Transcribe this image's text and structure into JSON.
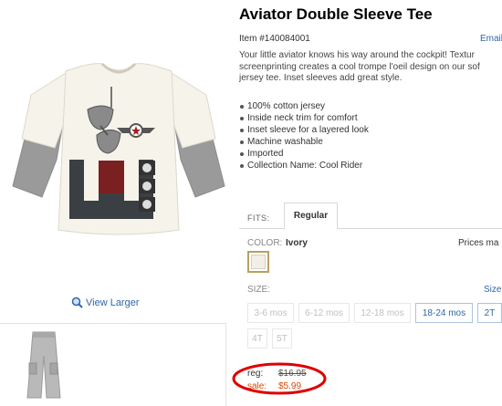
{
  "product": {
    "title": "Aviator Double Sleeve Tee",
    "item_number": "Item #140084001",
    "email_link": "Email",
    "description_lines": [
      "Your little aviator knows his way around the cockpit! Textur",
      "screenprinting creates a cool trompe l'oeil design on our sof",
      "jersey tee. Inset sleeves add great style."
    ],
    "features": [
      "100% cotton jersey",
      "Inside neck trim for comfort",
      "Inset sleeve for a layered look",
      "Machine washable",
      "Imported",
      "Collection Name: Cool Rider"
    ]
  },
  "gallery": {
    "view_larger": "View Larger",
    "main_image": "ivory-tee-gray-sleeves",
    "thumbnail": "gray-cargo-pants"
  },
  "fits": {
    "label": "FITS:",
    "tab": "Regular"
  },
  "color": {
    "label": "COLOR:",
    "value": "Ivory",
    "prices_note": "Prices ma",
    "swatch_color": "#f3efe6"
  },
  "size": {
    "label": "SIZE:",
    "chart_link": "Size",
    "options": [
      {
        "label": "3-6 mos",
        "available": false
      },
      {
        "label": "6-12 mos",
        "available": false
      },
      {
        "label": "12-18 mos",
        "available": false
      },
      {
        "label": "18-24 mos",
        "available": true
      },
      {
        "label": "2T",
        "available": true
      },
      {
        "label": "4T",
        "available": false
      },
      {
        "label": "5T",
        "available": false
      }
    ]
  },
  "price": {
    "reg_label": "reg:",
    "reg_value": "$16.95",
    "sale_label": "sale:",
    "sale_value": "$5.99"
  },
  "colors": {
    "link": "#2f66a9",
    "sale": "#d84a00",
    "highlight_circle": "#e00000"
  }
}
